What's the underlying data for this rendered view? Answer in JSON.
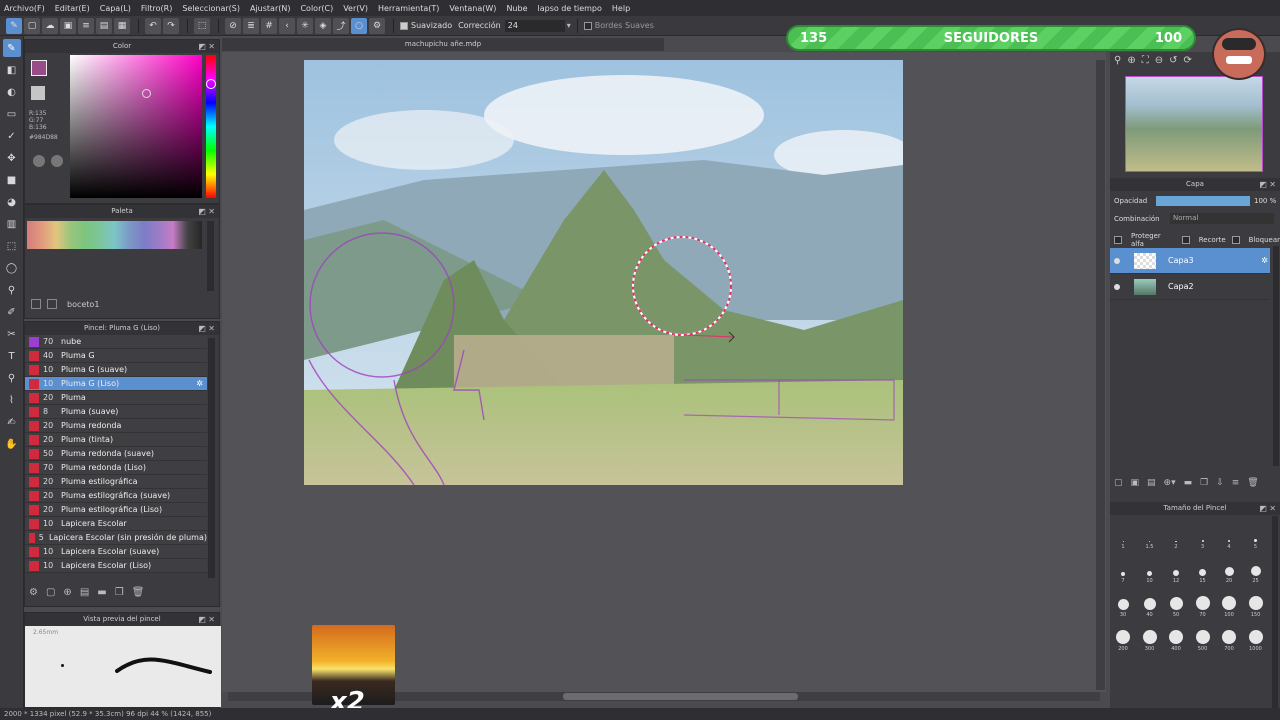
{
  "menu": [
    "Archivo(F)",
    "Editar(E)",
    "Capa(L)",
    "Filtro(R)",
    "Seleccionar(S)",
    "Ajustar(N)",
    "Color(C)",
    "Ver(V)",
    "Herramienta(T)",
    "Ventana(W)",
    "Nube",
    "lapso de tiempo",
    "Help"
  ],
  "toolbar": {
    "smooth_label": "Suavizado",
    "correction_label": "Corrección",
    "correction_value": "24",
    "soft_edges_label": "Bordes Suaves"
  },
  "document_tab": "machupichu añe.mdp",
  "color_panel": {
    "title": "Color",
    "r": "R:135",
    "g": "G:77",
    "b": "B:136",
    "hex": "#984D88"
  },
  "palette_panel": {
    "title": "Paleta",
    "layer_name": "boceto1"
  },
  "brush_panel": {
    "title": "Pincel: Pluma G (Liso)",
    "items": [
      {
        "size": "70",
        "name": "nube",
        "color": "#9b3fd0"
      },
      {
        "size": "40",
        "name": "Pluma G",
        "color": "#d02a3f"
      },
      {
        "size": "10",
        "name": "Pluma G (suave)",
        "color": "#d02a3f"
      },
      {
        "size": "10",
        "name": "Pluma G (Liso)",
        "color": "#d02a3f"
      },
      {
        "size": "20",
        "name": "Pluma",
        "color": "#d02a3f"
      },
      {
        "size": "8",
        "name": "Pluma (suave)",
        "color": "#d02a3f"
      },
      {
        "size": "20",
        "name": "Pluma redonda",
        "color": "#d02a3f"
      },
      {
        "size": "20",
        "name": "Pluma (tinta)",
        "color": "#d02a3f"
      },
      {
        "size": "50",
        "name": "Pluma redonda (suave)",
        "color": "#d02a3f"
      },
      {
        "size": "70",
        "name": "Pluma redonda (Liso)",
        "color": "#d02a3f"
      },
      {
        "size": "20",
        "name": "Pluma estilográfica",
        "color": "#d02a3f"
      },
      {
        "size": "20",
        "name": "Pluma estilográfica (suave)",
        "color": "#d02a3f"
      },
      {
        "size": "20",
        "name": "Pluma estilográfica (Liso)",
        "color": "#d02a3f"
      },
      {
        "size": "10",
        "name": "Lapicera Escolar",
        "color": "#d02a3f"
      },
      {
        "size": "5",
        "name": "Lapicera Escolar (sin presión de pluma)",
        "color": "#d02a3f"
      },
      {
        "size": "10",
        "name": "Lapicera Escolar (suave)",
        "color": "#d02a3f"
      },
      {
        "size": "10",
        "name": "Lapicera Escolar (Liso)",
        "color": "#d02a3f"
      }
    ]
  },
  "preview_panel": {
    "title": "Vista previa del pincel",
    "size_text": "2.65mm"
  },
  "layer_panel": {
    "title": "Capa",
    "opacity_label": "Opacidad",
    "opacity_value": "100 %",
    "blend_label": "Combinación",
    "blend_value": "Normal",
    "protect_alpha": "Proteger alfa",
    "clip": "Recorte",
    "lock": "Bloquear",
    "layers": [
      {
        "name": "Capa3",
        "selected": true
      },
      {
        "name": "Capa2",
        "selected": false
      }
    ]
  },
  "brush_size_panel": {
    "title": "Tamaño del Pincel",
    "sizes": [
      "1",
      "1.5",
      "2",
      "3",
      "4",
      "5",
      "7",
      "10",
      "12",
      "15",
      "20",
      "25",
      "30",
      "40",
      "50",
      "70",
      "100",
      "150",
      "200",
      "300",
      "400",
      "500",
      "700",
      "1000"
    ]
  },
  "status_bar": "2000 * 1334 pixel (52.9 * 35.3cm) 96 dpi 44 % (1424, 855)",
  "overlay": {
    "left_count": "135",
    "label": "SEGUIDORES",
    "right_count": "100",
    "multiplier": "x2"
  }
}
